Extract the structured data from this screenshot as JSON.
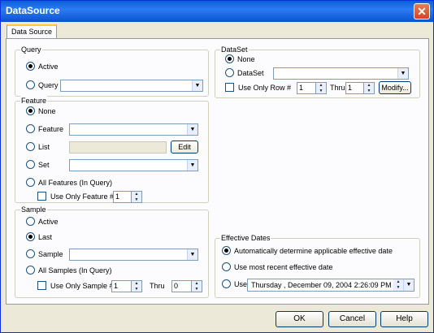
{
  "window": {
    "title": "DataSource",
    "close_symbol": "✕"
  },
  "tab": {
    "label": "Data Source"
  },
  "query": {
    "label": "Query",
    "active_label": "Active",
    "query_label": "Query",
    "selected": "Active",
    "query_combo_value": ""
  },
  "feature": {
    "label": "Feature",
    "none_label": "None",
    "feature_label": "Feature",
    "list_label": "List",
    "edit_label": "Edit",
    "set_label": "Set",
    "all_label": "All Features (In Query)",
    "use_only_label": "Use Only Feature #",
    "use_only_value": "1",
    "selected": "None"
  },
  "sample": {
    "label": "Sample",
    "active_label": "Active",
    "last_label": "Last",
    "sample_label": "Sample",
    "all_label": "All Samples (In Query)",
    "use_only_label": "Use Only Sample #",
    "use_only_value": "1",
    "thru_label": "Thru",
    "thru_value": "0",
    "selected": "Last"
  },
  "dataset": {
    "label": "DataSet",
    "none_label": "None",
    "dataset_label": "DataSet",
    "use_only_label": "Use Only Row #",
    "use_only_value": "1",
    "thru_label": "Thru",
    "thru_value": "1",
    "modify_label": "Modify...",
    "selected": "None"
  },
  "effective_dates": {
    "label": "Effective Dates",
    "auto_label": "Automatically determine applicable effective date",
    "recent_label": "Use most recent effective date",
    "use_label": "Use",
    "date_value": "Thursday   , December 09, 2004  2:26:09 PM",
    "selected": "Automatically determine applicable effective date"
  },
  "buttons": {
    "ok": "OK",
    "cancel": "Cancel",
    "help": "Help"
  }
}
